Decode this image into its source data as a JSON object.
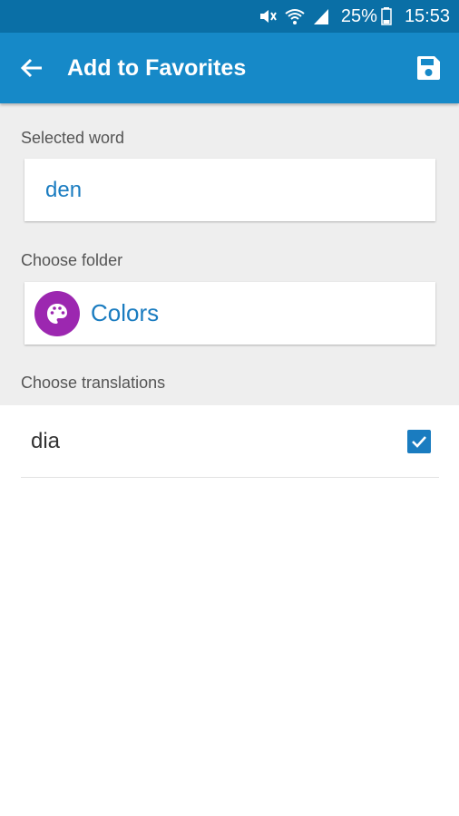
{
  "status_bar": {
    "battery": "25%",
    "time": "15:53"
  },
  "app_bar": {
    "title": "Add to Favorites"
  },
  "form": {
    "selected_word_label": "Selected word",
    "selected_word": "den",
    "choose_folder_label": "Choose folder",
    "folder_name": "Colors",
    "folder_icon": "palette-icon",
    "choose_translations_label": "Choose translations"
  },
  "translations": [
    {
      "text": "dia",
      "checked": true
    }
  ],
  "colors": {
    "status_bar": "#0a6fa6",
    "app_bar": "#1689c8",
    "accent": "#1a7cc0",
    "folder_avatar": "#9c27b0",
    "form_background": "#eeeeee"
  }
}
